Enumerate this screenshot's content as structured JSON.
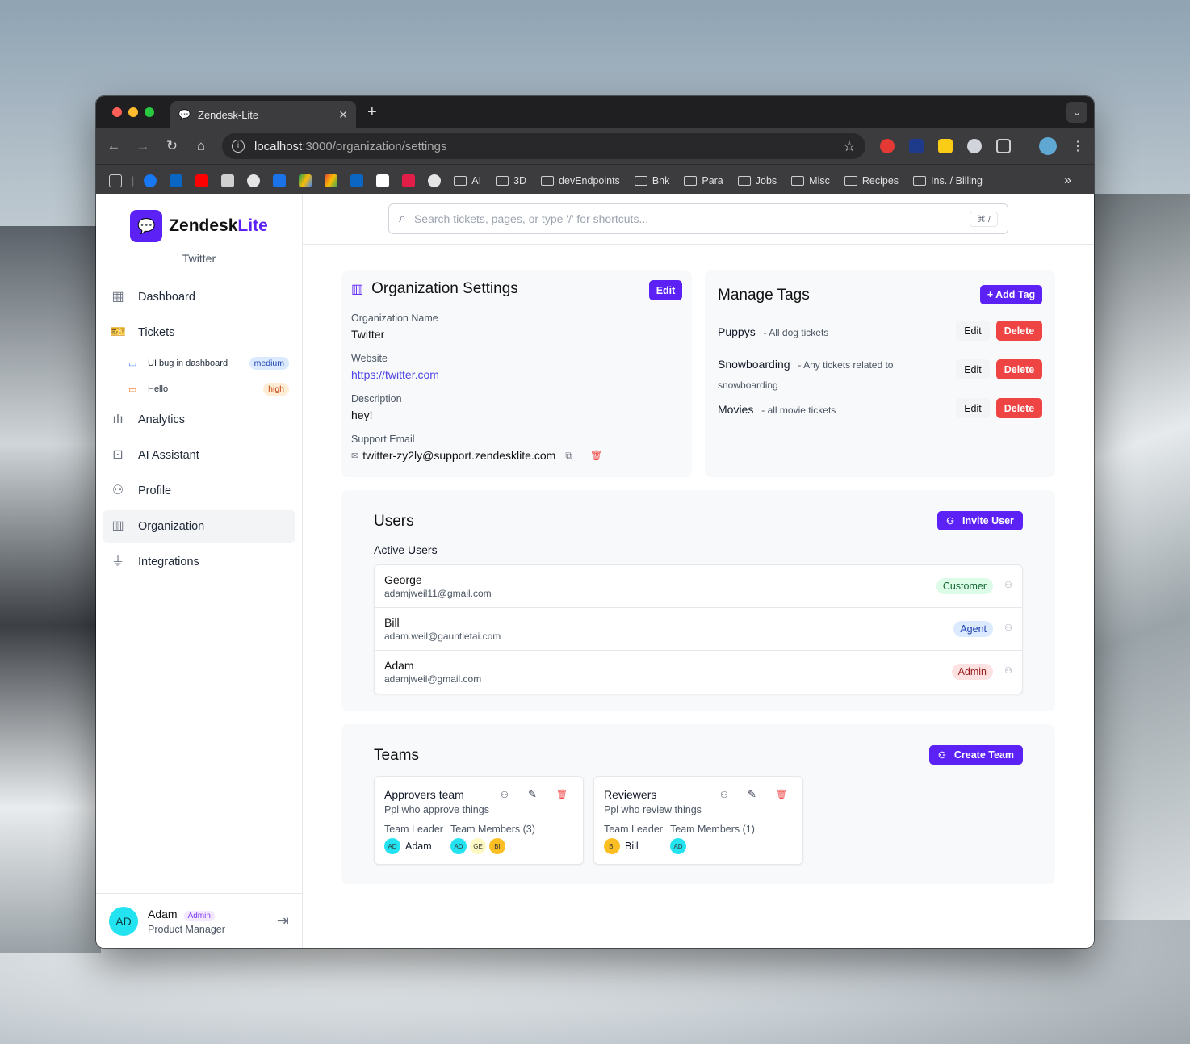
{
  "browser": {
    "tab_title": "Zendesk-Lite",
    "url_host": "localhost",
    "url_path": ":3000/organization/settings",
    "bookmarks": [
      "AI",
      "3D",
      "devEndpoints",
      "Bnk",
      "Para",
      "Jobs",
      "Misc",
      "Recipes",
      "Ins. / Billing"
    ],
    "traffic_colors": [
      "#ff5f57",
      "#febc2e",
      "#28c840"
    ]
  },
  "sidebar": {
    "brand_main": "Zendesk",
    "brand_accent": "Lite",
    "org_name": "Twitter",
    "nav": {
      "dashboard": "Dashboard",
      "tickets": "Tickets",
      "analytics": "Analytics",
      "ai_assistant": "AI Assistant",
      "profile": "Profile",
      "organization": "Organization",
      "integrations": "Integrations"
    },
    "tickets": [
      {
        "title": "UI bug in dashboard",
        "priority": "medium"
      },
      {
        "title": "Hello",
        "priority": "high"
      }
    ],
    "user": {
      "initials": "AD",
      "name": "Adam",
      "badge": "Admin",
      "role": "Product Manager"
    }
  },
  "search": {
    "placeholder": "Search tickets, pages, or type '/' for shortcuts...",
    "shortcut": "⌘ /"
  },
  "org_settings": {
    "title": "Organization Settings",
    "edit_label": "Edit",
    "name_label": "Organization Name",
    "name_value": "Twitter",
    "website_label": "Website",
    "website_value": "https://twitter.com",
    "description_label": "Description",
    "description_value": "hey!",
    "email_label": "Support Email",
    "email_value": "twitter-zy2ly@support.zendesklite.com"
  },
  "tags": {
    "title": "Manage Tags",
    "add_label": "+ Add Tag",
    "edit_label": "Edit",
    "delete_label": "Delete",
    "items": [
      {
        "name": "Puppys",
        "desc": "- All dog tickets"
      },
      {
        "name": "Snowboarding",
        "desc": "- Any tickets related to",
        "desc2": "snowboarding"
      },
      {
        "name": "Movies",
        "desc": "- all movie tickets"
      }
    ]
  },
  "users": {
    "title": "Users",
    "invite_label": "Invite User",
    "active_label": "Active Users",
    "rows": [
      {
        "name": "George",
        "email": "adamjweil11@gmail.com",
        "role": "Customer"
      },
      {
        "name": "Bill",
        "email": "adam.weil@gauntletai.com",
        "role": "Agent"
      },
      {
        "name": "Adam",
        "email": "adamjweil@gmail.com",
        "role": "Admin"
      }
    ]
  },
  "teams": {
    "title": "Teams",
    "create_label": "Create Team",
    "leader_label": "Team Leader",
    "cards": [
      {
        "name": "Approvers team",
        "desc": "Ppl who approve things",
        "members_label": "Team Members (3)",
        "leader_initials": "AD",
        "leader_name": "Adam",
        "members": [
          "AD",
          "GE",
          "BI"
        ]
      },
      {
        "name": "Reviewers",
        "desc": "Ppl who review things",
        "members_label": "Team Members (1)",
        "leader_initials": "BI",
        "leader_name": "Bill",
        "members": [
          "AD"
        ]
      }
    ]
  }
}
